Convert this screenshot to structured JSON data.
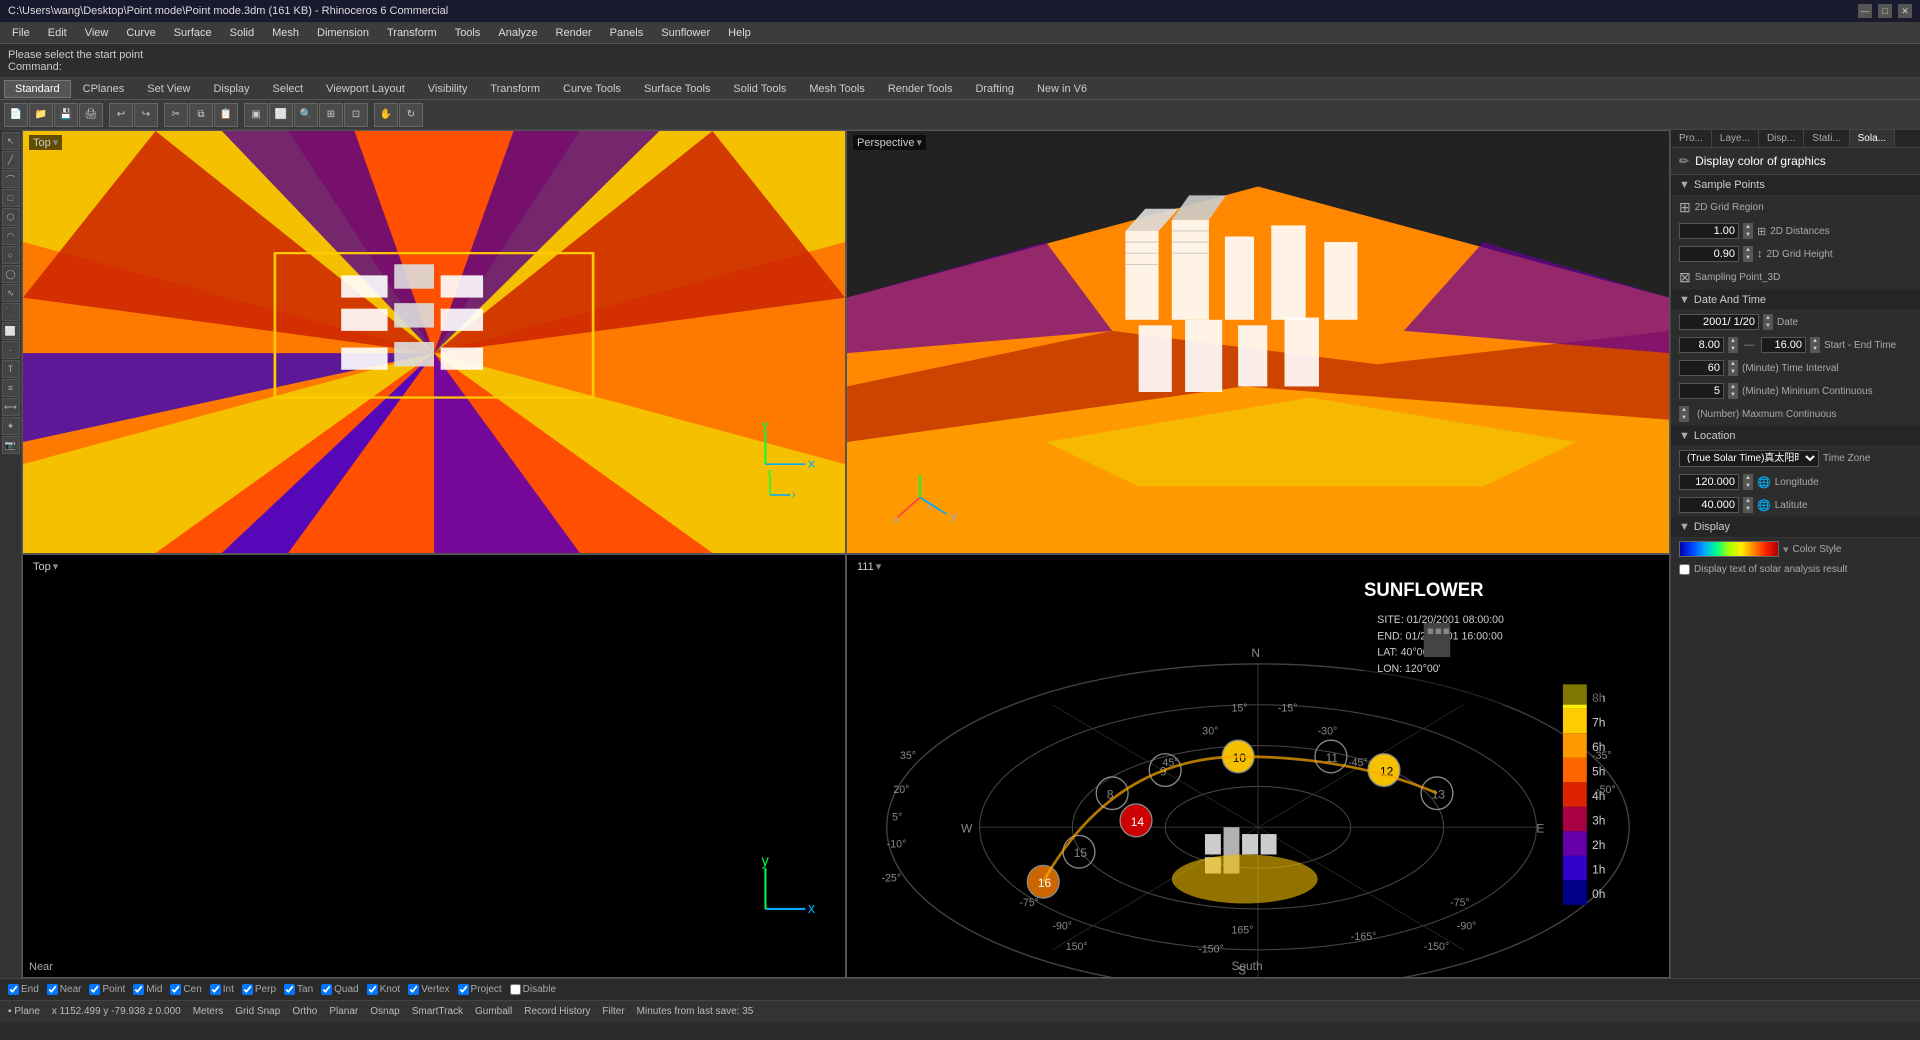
{
  "titlebar": {
    "title": "C:\\Users\\wang\\Desktop\\Point mode\\Point mode.3dm (161 KB) - Rhinoceros 6 Commercial",
    "min_btn": "—",
    "max_btn": "□",
    "close_btn": "✕"
  },
  "menubar": {
    "items": [
      "File",
      "Edit",
      "View",
      "Curve",
      "Surface",
      "Solid",
      "Mesh",
      "Dimension",
      "Transform",
      "Tools",
      "Analyze",
      "Render",
      "Panels",
      "Sunflower",
      "Help"
    ]
  },
  "command_bar": {
    "line1": "Please select the start point",
    "line2": "Command:"
  },
  "toolbar_tabs": {
    "items": [
      "Standard",
      "CPlanes",
      "Set View",
      "Display",
      "Select",
      "Viewport Layout",
      "Visibility",
      "Transform",
      "Curve Tools",
      "Surface Tools",
      "Solid Tools",
      "Mesh Tools",
      "Render Tools",
      "Drafting",
      "New in V6"
    ]
  },
  "viewports": {
    "top_left": {
      "label": "Top",
      "type": "top"
    },
    "top_right": {
      "label": "Perspective",
      "type": "perspective"
    },
    "bottom_left": {
      "label": "Top",
      "type": "top2"
    },
    "bottom_right": {
      "label": "111",
      "type": "solar"
    }
  },
  "right_panel": {
    "tabs": [
      "Pro...",
      "Laye...",
      "Disp...",
      "Stati...",
      "Sola..."
    ],
    "active_tab": "Sola...",
    "title": "Display color of graphics",
    "sections": {
      "sample_points": {
        "label": "Sample Points",
        "expanded": true,
        "fields": {
          "grid_region_label": "2D Grid Region",
          "distance_label": "2D Distances",
          "distance_value": "1.00",
          "height_label": "2D Grid Height",
          "height_value": "0.90",
          "sampling_3d_label": "Sampling Point_3D"
        }
      },
      "date_time": {
        "label": "Date And Time",
        "expanded": true,
        "fields": {
          "date_label": "Date",
          "date_value": "2001/ 1/20",
          "start_end_label": "Start - End Time",
          "start_time": "8.00",
          "end_time": "16.00",
          "interval_label": "(Minute) Time Interval",
          "interval_value": "60",
          "min_cont_label": "(Minute) Mininum Continuous",
          "min_cont_value": "5",
          "max_cont_label": "(Number) Maxmum Continuous"
        }
      },
      "location": {
        "label": "Location",
        "expanded": true,
        "fields": {
          "timezone_label": "Time Zone",
          "timezone_value": "(True Solar Time)真太阳时",
          "longitude_label": "Longitude",
          "longitude_value": "120.000",
          "latitude_label": "Latitute",
          "latitude_value": "40.000"
        }
      },
      "display": {
        "label": "Display",
        "expanded": true,
        "fields": {
          "color_style_label": "Color Style",
          "show_text_label": "Display text of solar analysis result",
          "show_text_checked": false
        }
      }
    }
  },
  "solar_diagram": {
    "title": "SUNFLOWER",
    "site_info": "SITE: 01/20/2001 08:00:00",
    "end_info": "END: 01/20/2001 16:00:00",
    "lat": "LAT: 40°00'",
    "lon": "LON: 120°00'",
    "hours": [
      "8h",
      "7h",
      "6h",
      "5h",
      "4h",
      "3h",
      "2h",
      "1h",
      "0h"
    ],
    "hour_numbers": [
      "13",
      "14",
      "15",
      "16",
      "8",
      "9",
      "10",
      "11",
      "12"
    ]
  },
  "status_bar": {
    "snap_items": [
      "End",
      "Near",
      "Point",
      "Mid",
      "Cen",
      "Int",
      "Perp",
      "Tan",
      "Quad",
      "Knot",
      "Vertex",
      "Project",
      "Disable"
    ],
    "bottom": {
      "plane": "Plane",
      "coords": "x 1152.499  y -79.938  z 0.000",
      "unit": "Meters",
      "grid_snap": "Grid Snap",
      "ortho": "Ortho",
      "planar": "Planar",
      "osnap": "Osnap",
      "smart_track": "SmartTrack",
      "gumball": "Gumball",
      "record_history": "Record History",
      "filter": "Filter",
      "save_info": "Minutes from last save: 35"
    }
  },
  "viewport_labels": {
    "top": "Top",
    "perspective": "Perspective",
    "near": "Near"
  }
}
